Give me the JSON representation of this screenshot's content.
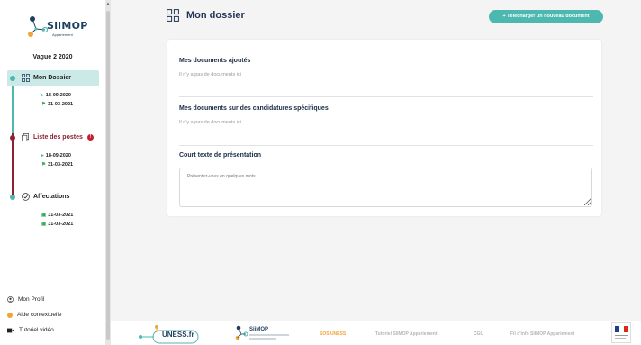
{
  "sidebar": {
    "logo_text": "SiiMOP",
    "logo_sub": "Appariement",
    "vague": "Vague 2 2020",
    "items": [
      {
        "label": "Mon Dossier",
        "dates": [
          "18-09-2020",
          "31-03-2021"
        ]
      },
      {
        "label": "Liste des postes",
        "badge": "!",
        "dates": [
          "18-09-2020",
          "31-03-2021"
        ]
      },
      {
        "label": "Affectations",
        "dates": [
          "31-03-2021",
          "31-03-2021"
        ]
      }
    ],
    "bottom": {
      "profil": "Mon Profil",
      "aide": "Aide contextuelle",
      "tutoriel": "Tutoriel vidéo"
    }
  },
  "main": {
    "title": "Mon dossier",
    "upload_button": "+ Télécharger un nouveau document",
    "sections": {
      "ajoutes_title": "Mes documents ajoutés",
      "ajoutes_empty": "Il n'y a pas de documents ici",
      "specifiques_title": "Mes documents sur des candidatures spécifiques",
      "specifiques_empty": "Il n'y a pas de documents ici",
      "presentation_title": "Court texte de présentation",
      "presentation_placeholder": "Présentez-vous en quelques mots..."
    }
  },
  "footer": {
    "uness": "UNESS.fr",
    "siimop": "SiiMOP",
    "sos": "SOS UNESS",
    "tutoriel": "Tutoriel SIIMOP Appariement",
    "cgu": "CGU",
    "fil": "Fil d'info SIIMOP Appariement"
  },
  "colors": {
    "teal": "#4cb8b0",
    "dark_red": "#8b2232",
    "navy": "#1f3554",
    "orange": "#f2a43a"
  }
}
